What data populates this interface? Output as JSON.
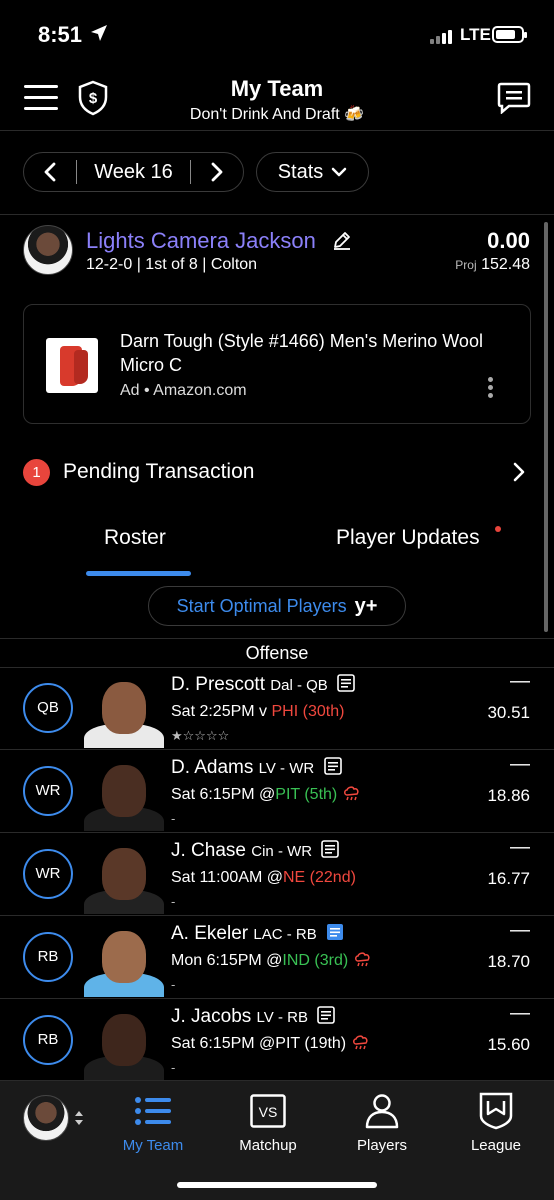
{
  "status_bar": {
    "time": "8:51",
    "network": "LTE",
    "battery_level": 0.8
  },
  "header": {
    "title": "My Team",
    "subtitle": "Don't Drink And Draft 🍻"
  },
  "controls": {
    "week_label": "Week 16",
    "stats_label": "Stats"
  },
  "team": {
    "name": "Lights Camera Jackson",
    "record": "12-2-0 | 1st of 8 | Colton",
    "score": "0.00",
    "proj_label": "Proj",
    "proj_value": "152.48"
  },
  "ad": {
    "title": "Darn Tough (Style #1466) Men's Merino Wool Micro C",
    "source": "Ad • Amazon.com"
  },
  "pending": {
    "count": "1",
    "label": "Pending Transaction"
  },
  "tabs": {
    "roster": "Roster",
    "updates": "Player Updates"
  },
  "optimal": {
    "label": "Start Optimal Players",
    "badge": "y+"
  },
  "section": {
    "offense": "Offense"
  },
  "players": [
    {
      "pos": "QB",
      "name": "D. Prescott",
      "team": "Dal - QB",
      "time": "Sat 2:25PM v ",
      "opp": "PHI (30th)",
      "opp_color": "red",
      "sub": "★☆☆☆☆",
      "dash": "—",
      "proj": "30.51"
    },
    {
      "pos": "WR",
      "name": "D. Adams",
      "team": "LV - WR",
      "time": "Sat 6:15PM @",
      "opp": "PIT (5th)",
      "opp_color": "green",
      "sub": "-",
      "dash": "—",
      "proj": "18.86"
    },
    {
      "pos": "WR",
      "name": "J. Chase",
      "team": "Cin - WR",
      "time": "Sat 11:00AM @",
      "opp": "NE (22nd)",
      "opp_color": "red",
      "sub": "-",
      "dash": "—",
      "proj": "16.77"
    },
    {
      "pos": "RB",
      "name": "A. Ekeler",
      "team": "LAC - RB",
      "time": "Mon 6:15PM @",
      "opp": "IND (3rd)",
      "opp_color": "green",
      "sub": "-",
      "dash": "—",
      "proj": "18.70"
    },
    {
      "pos": "RB",
      "name": "J. Jacobs",
      "team": "LV - RB",
      "time": "Sat 6:15PM @PIT (19th)",
      "opp": "",
      "opp_color": "none",
      "sub": "-",
      "dash": "—",
      "proj": "15.60"
    }
  ],
  "nav": {
    "my_team": "My Team",
    "matchup": "Matchup",
    "matchup_glyph": "VS",
    "players": "Players",
    "league": "League"
  },
  "colors": {
    "accent": "#3d8bec",
    "team_name": "#8b80f9",
    "alert": "#e8453c",
    "good": "#39c154"
  }
}
